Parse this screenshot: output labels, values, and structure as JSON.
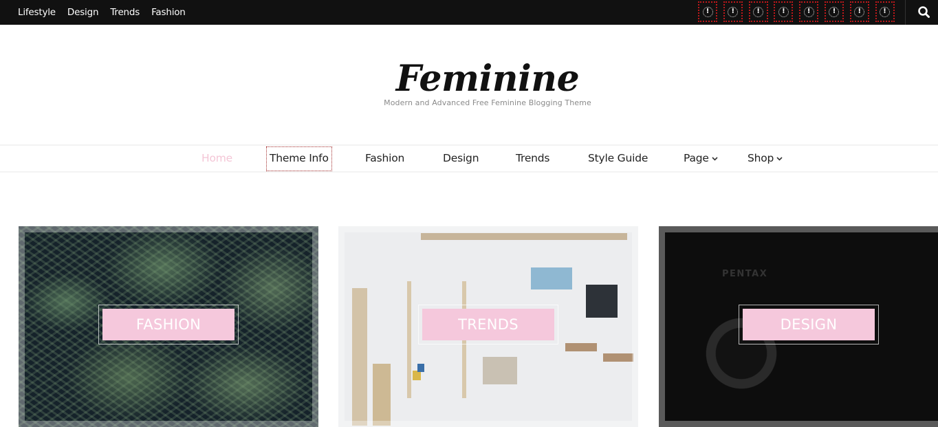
{
  "topbar": {
    "menu": [
      "Lifestyle",
      "Design",
      "Trends",
      "Fashion"
    ],
    "social_icons": [
      {
        "icon": "missing-icon",
        "glyph": "!"
      },
      {
        "icon": "missing-icon",
        "glyph": "!"
      },
      {
        "icon": "missing-icon",
        "glyph": "!"
      },
      {
        "icon": "missing-icon",
        "glyph": "!"
      },
      {
        "icon": "missing-icon",
        "glyph": "!"
      },
      {
        "icon": "missing-icon",
        "glyph": "!"
      },
      {
        "icon": "missing-icon",
        "glyph": "!"
      },
      {
        "icon": "missing-icon",
        "glyph": "!"
      }
    ],
    "search_icon": "search-icon"
  },
  "header": {
    "site_title": "Feminine",
    "tagline": "Modern and Advanced Free Feminine Blogging Theme"
  },
  "nav": {
    "items": [
      {
        "label": "Home",
        "active": true
      },
      {
        "label": "Theme Info",
        "focused": true
      },
      {
        "label": "Fashion"
      },
      {
        "label": "Design"
      },
      {
        "label": "Trends"
      },
      {
        "label": "Style Guide"
      },
      {
        "label": "Page",
        "has_dropdown": true
      },
      {
        "label": "Shop",
        "has_dropdown": true
      }
    ]
  },
  "categories": [
    {
      "label": "FASHION"
    },
    {
      "label": "TRENDS"
    },
    {
      "label": "DESIGN",
      "photo_text": "PENTAX"
    }
  ],
  "colors": {
    "topbar_bg": "#111111",
    "accent_pink": "#f5c8dc",
    "active_nav": "#f4c6d6",
    "focus_outline": "#a22a2a"
  }
}
